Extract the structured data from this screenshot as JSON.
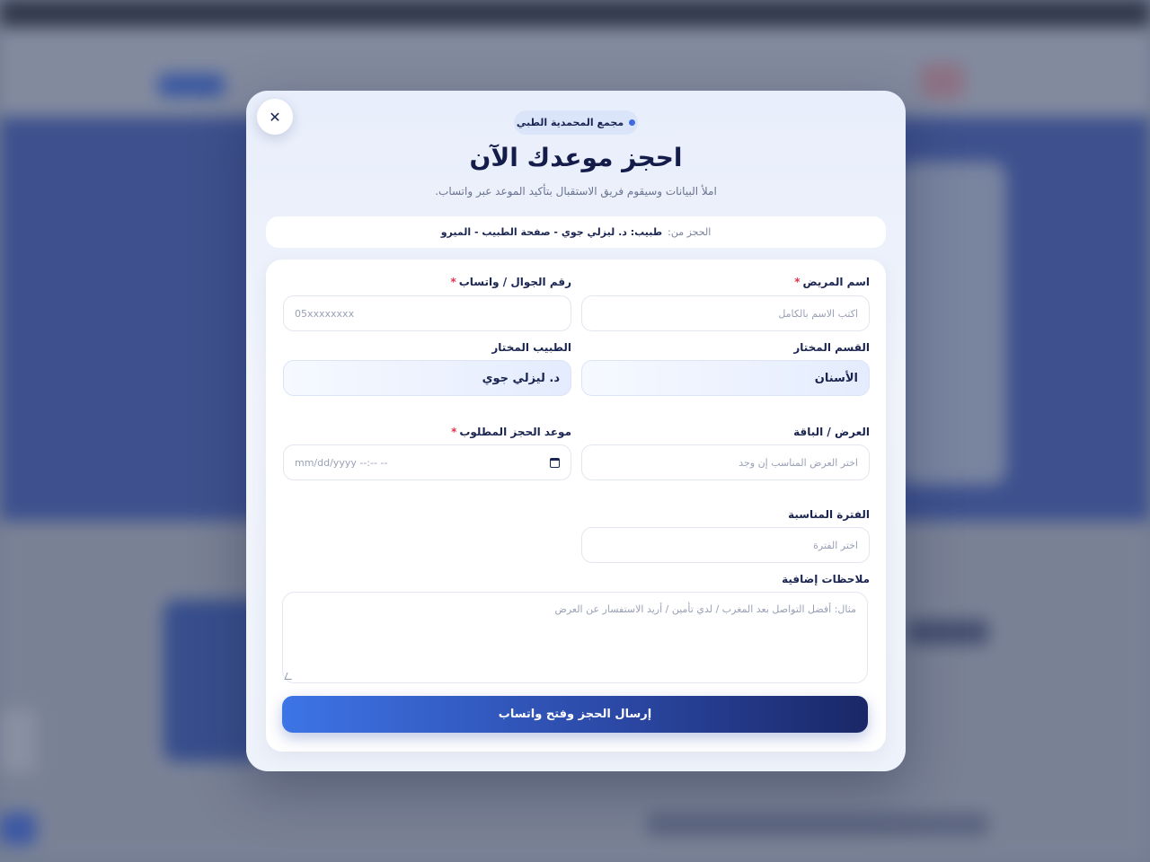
{
  "modal": {
    "close_icon": "✕",
    "badge": "مجمع المحمدية الطبي",
    "title": "احجز موعدك الآن",
    "subtitle": "املأ البيانات وسيقوم فريق الاستقبال بتأكيد الموعد عبر واتساب.",
    "source": {
      "label": "الحجز من:",
      "value": "طبيب: د. ليزلي جوي - صفحة الطبيب - الميرو"
    }
  },
  "form": {
    "patient_name": {
      "label": "اسم المريض",
      "placeholder": "اكتب الاسم بالكامل",
      "required": "*"
    },
    "phone": {
      "label": "رقم الجوال / واتساب",
      "placeholder": "05xxxxxxxx",
      "required": "*"
    },
    "department": {
      "label": "القسم المختار",
      "value": "الأسنان"
    },
    "doctor": {
      "label": "الطبيب المختار",
      "value": "د. ليزلي جوي"
    },
    "offer": {
      "label": "العرض / الباقة",
      "placeholder": "اختر العرض المناسب إن وجد"
    },
    "date": {
      "label": "موعد الحجز المطلوب",
      "placeholder": "mm/dd/yyyy --:-- --",
      "required": "*",
      "icon": "calendar-icon"
    },
    "period": {
      "label": "الفترة المناسبة",
      "placeholder": "اختر الفترة"
    },
    "notes": {
      "label": "ملاحظات إضافية",
      "placeholder": "مثال: أفضل التواصل بعد المغرب / لدي تأمين / أريد الاستفسار عن العرض"
    },
    "submit_label": "إرسال الحجز وفتح واتساب"
  },
  "colors": {
    "accent": "#3f6ae0",
    "text_dark": "#1b2552",
    "required": "#e0344b",
    "button_start": "#3d74e6",
    "button_end": "#1a2767"
  }
}
